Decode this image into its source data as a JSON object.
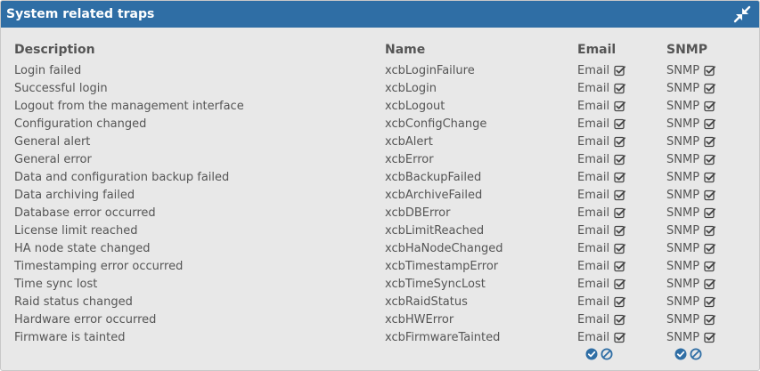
{
  "panel": {
    "title": "System related traps"
  },
  "columns": {
    "description": "Description",
    "name": "Name",
    "email": "Email",
    "snmp": "SNMP"
  },
  "rows": [
    {
      "description": "Login failed",
      "name": "xcbLoginFailure",
      "email": "Email",
      "snmp": "SNMP",
      "email_checked": true,
      "snmp_checked": true
    },
    {
      "description": "Successful login",
      "name": "xcbLogin",
      "email": "Email",
      "snmp": "SNMP",
      "email_checked": true,
      "snmp_checked": true
    },
    {
      "description": "Logout from the management interface",
      "name": "xcbLogout",
      "email": "Email",
      "snmp": "SNMP",
      "email_checked": true,
      "snmp_checked": true
    },
    {
      "description": "Configuration changed",
      "name": "xcbConfigChange",
      "email": "Email",
      "snmp": "SNMP",
      "email_checked": true,
      "snmp_checked": true
    },
    {
      "description": "General alert",
      "name": "xcbAlert",
      "email": "Email",
      "snmp": "SNMP",
      "email_checked": true,
      "snmp_checked": true
    },
    {
      "description": "General error",
      "name": "xcbError",
      "email": "Email",
      "snmp": "SNMP",
      "email_checked": true,
      "snmp_checked": true
    },
    {
      "description": "Data and configuration backup failed",
      "name": "xcbBackupFailed",
      "email": "Email",
      "snmp": "SNMP",
      "email_checked": true,
      "snmp_checked": true
    },
    {
      "description": "Data archiving failed",
      "name": "xcbArchiveFailed",
      "email": "Email",
      "snmp": "SNMP",
      "email_checked": true,
      "snmp_checked": true
    },
    {
      "description": "Database error occurred",
      "name": "xcbDBError",
      "email": "Email",
      "snmp": "SNMP",
      "email_checked": true,
      "snmp_checked": true
    },
    {
      "description": "License limit reached",
      "name": "xcbLimitReached",
      "email": "Email",
      "snmp": "SNMP",
      "email_checked": true,
      "snmp_checked": true
    },
    {
      "description": "HA node state changed",
      "name": "xcbHaNodeChanged",
      "email": "Email",
      "snmp": "SNMP",
      "email_checked": true,
      "snmp_checked": true
    },
    {
      "description": "Timestamping error occurred",
      "name": "xcbTimestampError",
      "email": "Email",
      "snmp": "SNMP",
      "email_checked": true,
      "snmp_checked": true
    },
    {
      "description": "Time sync lost",
      "name": "xcbTimeSyncLost",
      "email": "Email",
      "snmp": "SNMP",
      "email_checked": true,
      "snmp_checked": true
    },
    {
      "description": "Raid status changed",
      "name": "xcbRaidStatus",
      "email": "Email",
      "snmp": "SNMP",
      "email_checked": true,
      "snmp_checked": true
    },
    {
      "description": "Hardware error occurred",
      "name": "xcbHWError",
      "email": "Email",
      "snmp": "SNMP",
      "email_checked": true,
      "snmp_checked": true
    },
    {
      "description": "Firmware is tainted",
      "name": "xcbFirmwareTainted",
      "email": "Email",
      "snmp": "SNMP",
      "email_checked": true,
      "snmp_checked": true
    }
  ],
  "colors": {
    "header_bg": "#2f6ea5",
    "panel_bg": "#e8e8e8",
    "text": "#555555",
    "accent": "#2f6ea5"
  },
  "icons": {
    "collapse": "collapse-arrows-icon",
    "checkbox": "checkbox-checked-icon",
    "select_all": "check-all-icon",
    "deselect_all": "deselect-all-icon"
  }
}
